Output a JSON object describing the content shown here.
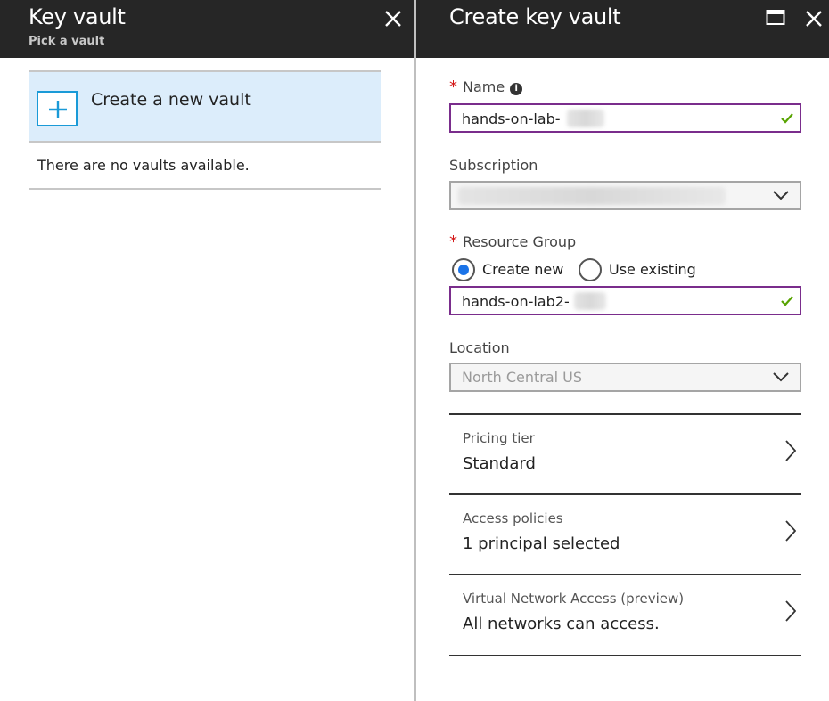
{
  "left_blade": {
    "title": "Key vault",
    "subtitle": "Pick a vault",
    "close_icon": "close-icon",
    "create_new_label": "Create a new vault",
    "plus_icon": "plus-icon",
    "empty_message": "There are no vaults available."
  },
  "right_blade": {
    "title": "Create key vault",
    "maximize_icon": "maximize-icon",
    "close_icon": "close-icon",
    "name": {
      "label": "Name",
      "required": "*",
      "info_icon": "info-icon",
      "value": "hands-on-lab-"
    },
    "subscription": {
      "label": "Subscription",
      "value": ""
    },
    "resource_group": {
      "label": "Resource Group",
      "required": "*",
      "options": [
        "Create new",
        "Use existing"
      ],
      "selected": "Create new",
      "value": "hands-on-lab2-"
    },
    "location": {
      "label": "Location",
      "value": "North Central US"
    },
    "pricing_tier": {
      "label": "Pricing tier",
      "value": "Standard"
    },
    "access_policies": {
      "label": "Access policies",
      "value": "1 principal selected"
    },
    "network_access": {
      "label": "Virtual Network Access (preview)",
      "value": "All networks can access."
    }
  },
  "colors": {
    "header_bg": "#262626",
    "accent_blue": "#1a9ad7",
    "selection_bg": "#dcedfb",
    "input_border_active": "#7a2d8c",
    "valid_check": "#57a300",
    "required_star": "#d41919",
    "radio_selected": "#1a73e8"
  }
}
